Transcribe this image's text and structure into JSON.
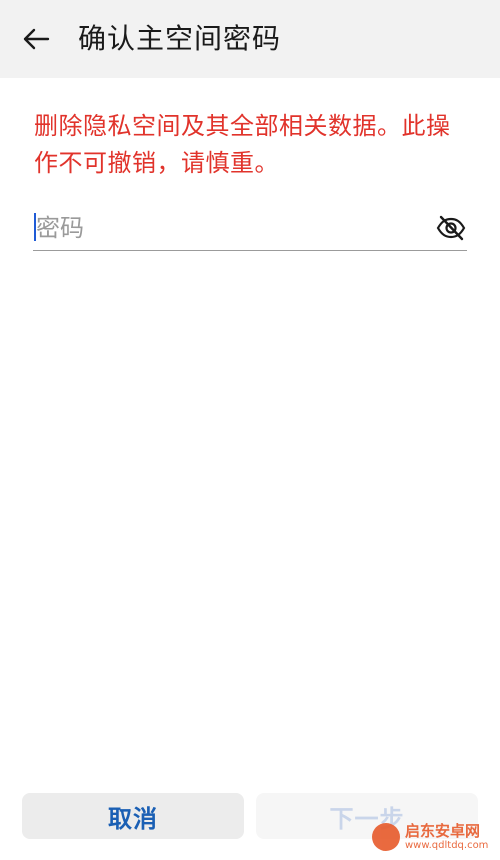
{
  "header": {
    "title": "确认主空间密码"
  },
  "warning": {
    "text": "删除隐私空间及其全部相关数据。此操作不可撤销，请慎重。"
  },
  "password": {
    "placeholder": "密码",
    "value": ""
  },
  "icons": {
    "back": "arrow-left-icon",
    "visibility": "eye-off-icon"
  },
  "buttons": {
    "cancel_label": "取消",
    "next_label": "下一步"
  },
  "watermark": {
    "name": "启东安卓网",
    "url": "www.qdltdq.com"
  },
  "colors": {
    "warning": "#e1332b",
    "accent": "#1a5fb4",
    "header_bg": "#f2f2f2"
  }
}
